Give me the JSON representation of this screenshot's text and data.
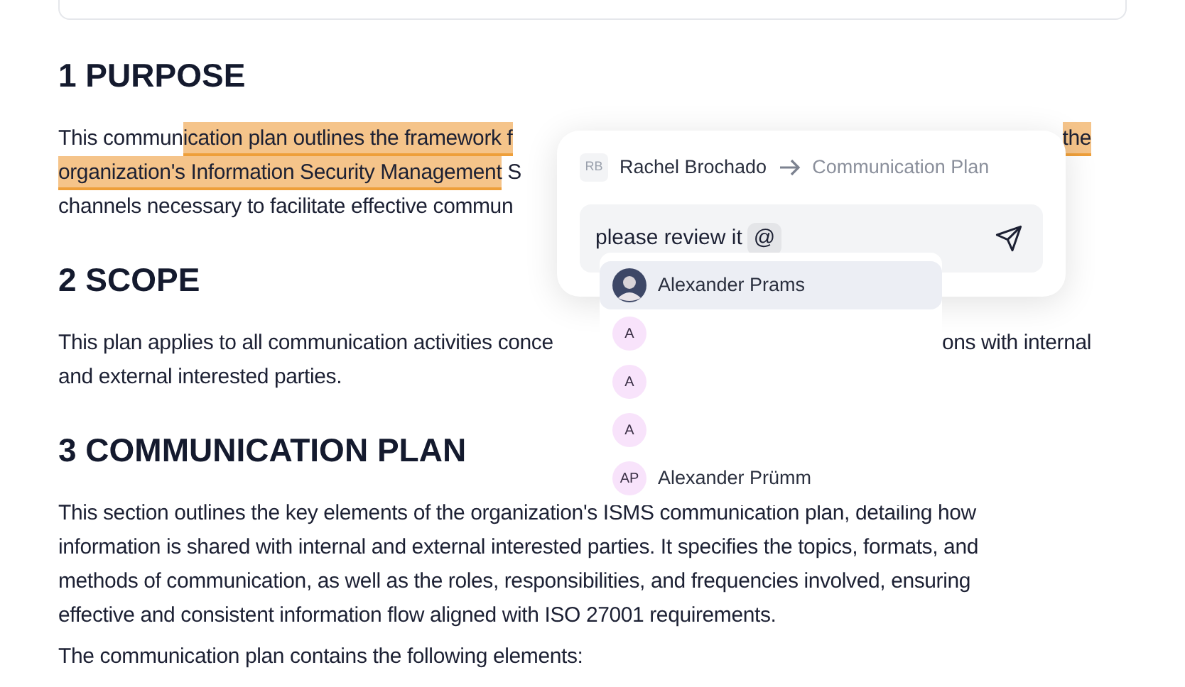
{
  "sections": [
    {
      "heading": "1 PURPOSE",
      "lines": [
        {
          "left": [
            {
              "text": "This commun",
              "highlighted": false
            },
            {
              "text": "ication plan outlines the framework f",
              "highlighted": true
            }
          ],
          "right": [
            {
              "text": "the",
              "highlighted": true
            }
          ]
        },
        {
          "left": [
            {
              "text": "organization's Information Security Management",
              "highlighted": true
            },
            {
              "text": " S",
              "highlighted": false
            }
          ]
        },
        {
          "left": [
            {
              "text": "channels necessary to facilitate effective commun",
              "highlighted": false
            }
          ]
        }
      ]
    },
    {
      "heading": "2 SCOPE",
      "lines": [
        {
          "left": [
            {
              "text": "This plan applies to all communication activities conce",
              "highlighted": false
            }
          ],
          "right": [
            {
              "text": "ons with internal",
              "highlighted": false
            }
          ]
        },
        {
          "left": [
            {
              "text": "and external interested parties.",
              "highlighted": false
            }
          ]
        }
      ]
    },
    {
      "heading": "3 COMMUNICATION PLAN",
      "lines": [
        {
          "left": [
            {
              "text": "This section outlines the key elements of the organization's ISMS communication plan, detailing how",
              "highlighted": false
            }
          ]
        },
        {
          "left": [
            {
              "text": "information is shared with internal and external interested parties. It specifies the topics, formats, and",
              "highlighted": false
            }
          ]
        },
        {
          "left": [
            {
              "text": "methods of communication, as well as the roles, responsibilities, and frequencies involved, ensuring",
              "highlighted": false
            }
          ]
        },
        {
          "left": [
            {
              "text": "effective and consistent information flow aligned with ISO 27001 requirements.",
              "highlighted": false
            }
          ]
        }
      ]
    }
  ],
  "trailing_paragraph": "The communication plan contains the following elements:",
  "comment": {
    "author_initials": "RB",
    "author": "Rachel Brochado",
    "target": "Communication Plan",
    "value": "please review it",
    "mention_trigger": "@",
    "suggestions": [
      {
        "kind": "photo",
        "name": "Alexander Prams",
        "selected": true
      },
      {
        "kind": "initials",
        "initials": "A",
        "selected": false
      },
      {
        "kind": "initials",
        "initials": "A",
        "selected": false
      },
      {
        "kind": "initials",
        "initials": "A",
        "selected": false
      },
      {
        "kind": "initials",
        "initials": "AP",
        "name": "Alexander Prümm",
        "selected": false
      }
    ]
  }
}
